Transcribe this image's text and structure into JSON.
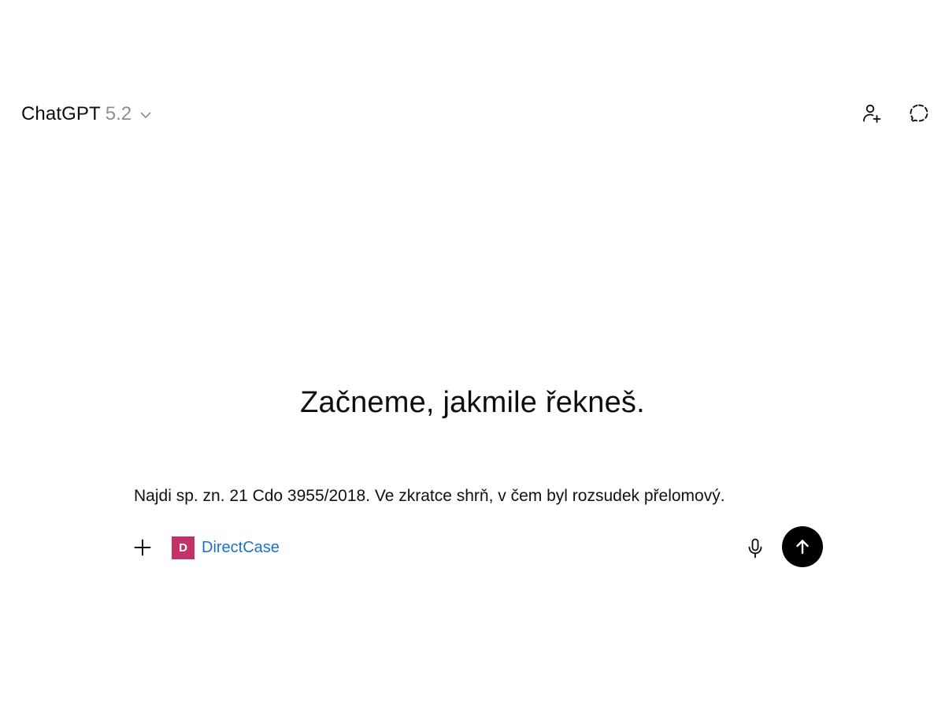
{
  "header": {
    "model_name": "ChatGPT",
    "model_version": "5.2",
    "model_chevron_icon": "chevron-down-icon",
    "actions": [
      {
        "icon": "add-person-icon"
      },
      {
        "icon": "temporary-chat-icon"
      }
    ]
  },
  "main": {
    "greeting": "Začneme, jakmile řekneš."
  },
  "composer": {
    "prompt_text": "Najdi sp. zn. 21 Cdo 3955/2018. Ve zkratce shrň, v čem byl rozsudek přelomový.",
    "plus_icon": "plus-icon",
    "connector": {
      "badge_letter": "D",
      "label": "DirectCase",
      "badge_color": "#c2336a",
      "label_color": "#1a73c9"
    },
    "mic_icon": "microphone-icon",
    "send_icon": "arrow-up-icon"
  },
  "colors": {
    "send_button_bg": "#000000",
    "version_text": "#8e8e8e"
  }
}
